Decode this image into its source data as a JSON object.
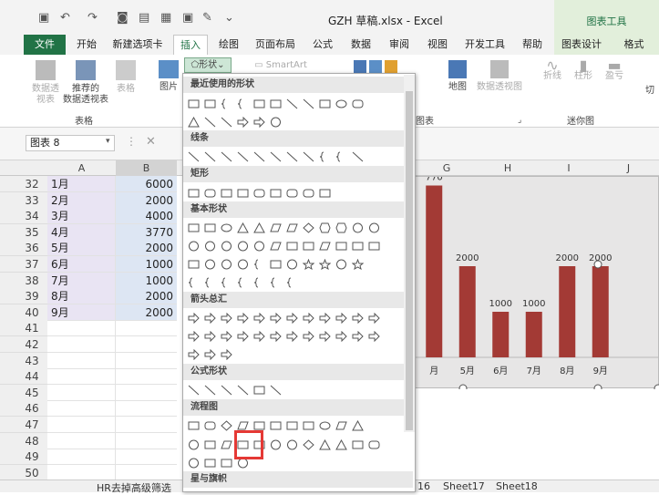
{
  "window": {
    "title": "GZH 草稿.xlsx - Excel",
    "chart_tools": "图表工具"
  },
  "tabs": [
    "文件",
    "开始",
    "新建选项卡",
    "插入",
    "绘图",
    "页面布局",
    "公式",
    "数据",
    "审阅",
    "视图",
    "开发工具",
    "帮助"
  ],
  "context_tabs": [
    "图表设计",
    "格式"
  ],
  "ribbon": {
    "pivot": "数据透\n视表",
    "rec_pivot": "推荐的\n数据透视表",
    "table": "表格",
    "group_table": "表格",
    "picture": "图片",
    "shapes": "形状",
    "smartart": "SmartArt",
    "map": "地图",
    "pivot_chart": "数据透视图",
    "line": "折线",
    "column": "柱形",
    "winloss": "盈亏",
    "more": "切",
    "group_chart": "图表",
    "group_sparkline": "迷你图"
  },
  "namebox": "图表 8",
  "columns": [
    "A",
    "B",
    "G",
    "H",
    "I",
    "J"
  ],
  "rows": [
    {
      "n": "32",
      "a": "1月",
      "b": "6000"
    },
    {
      "n": "33",
      "a": "2月",
      "b": "2000"
    },
    {
      "n": "34",
      "a": "3月",
      "b": "4000"
    },
    {
      "n": "35",
      "a": "4月",
      "b": "3770"
    },
    {
      "n": "36",
      "a": "5月",
      "b": "2000"
    },
    {
      "n": "37",
      "a": "6月",
      "b": "1000"
    },
    {
      "n": "38",
      "a": "7月",
      "b": "1000"
    },
    {
      "n": "39",
      "a": "8月",
      "b": "2000"
    },
    {
      "n": "40",
      "a": "9月",
      "b": "2000"
    },
    {
      "n": "41",
      "a": "",
      "b": ""
    },
    {
      "n": "42",
      "a": "",
      "b": ""
    },
    {
      "n": "43",
      "a": "",
      "b": ""
    },
    {
      "n": "44",
      "a": "",
      "b": ""
    },
    {
      "n": "45",
      "a": "",
      "b": ""
    },
    {
      "n": "46",
      "a": "",
      "b": ""
    },
    {
      "n": "47",
      "a": "",
      "b": ""
    },
    {
      "n": "48",
      "a": "",
      "b": ""
    },
    {
      "n": "49",
      "a": "",
      "b": ""
    },
    {
      "n": "50",
      "a": "",
      "b": ""
    }
  ],
  "chart_data": {
    "type": "bar",
    "categories": [
      "月",
      "5月",
      "6月",
      "7月",
      "8月",
      "9月"
    ],
    "values": [
      3770,
      2000,
      1000,
      1000,
      2000,
      2000
    ],
    "labels": [
      "770",
      "2000",
      "1000",
      "1000",
      "2000",
      "2000"
    ],
    "ylim": [
      0,
      4000
    ],
    "color": "#a33a35"
  },
  "shapes_panel": {
    "sections": [
      "最近使用的形状",
      "线条",
      "矩形",
      "基本形状",
      "箭头总汇",
      "公式形状",
      "流程图",
      "星与旗帜"
    ]
  },
  "sheets": [
    "HR去掉高级筛选",
    "16",
    "Sheet17",
    "Sheet18"
  ]
}
